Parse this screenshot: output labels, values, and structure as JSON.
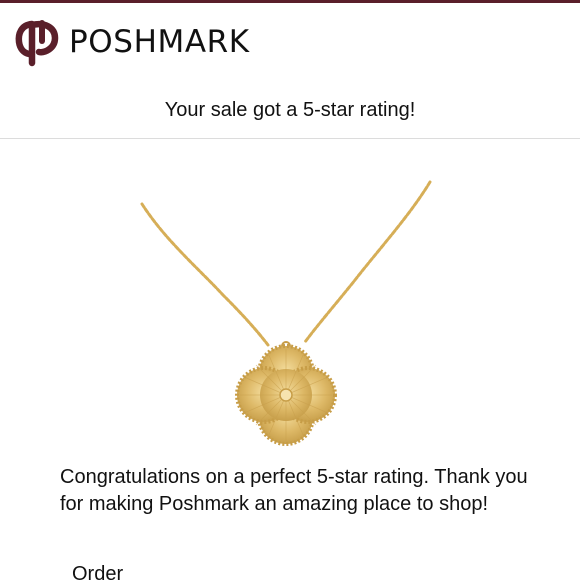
{
  "brand": {
    "name": "POSHMARK",
    "color": "#5a1f2a"
  },
  "email": {
    "subject_line": "Your sale got a 5-star rating!",
    "product_image_icon": "gold-clover-pendant-necklace",
    "message": "Congratulations on a perfect 5-star rating. Thank you for making Poshmark an amazing place to shop!",
    "order_label": "Order"
  },
  "colors": {
    "accent": "#5a1f2a",
    "text": "#111111",
    "divider": "#dcdcdc",
    "gold": "#d9b35c"
  }
}
